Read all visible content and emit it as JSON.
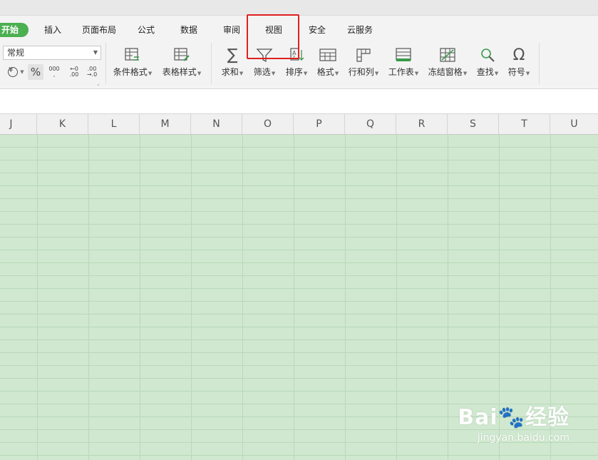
{
  "tabs": [
    {
      "label": "开始"
    },
    {
      "label": "插入"
    },
    {
      "label": "页面布局"
    },
    {
      "label": "公式"
    },
    {
      "label": "数据"
    },
    {
      "label": "审阅"
    },
    {
      "label": "视图"
    },
    {
      "label": "安全"
    },
    {
      "label": "云服务"
    }
  ],
  "number_format": {
    "value": "常规"
  },
  "format_buttons": {
    "currency": "¥",
    "percent": "%",
    "thousands": "000",
    "inc_decimal_top": "←0",
    "inc_decimal_bottom": ".00",
    "dec_decimal_top": ".00",
    "dec_decimal_bottom": "→.0"
  },
  "tools": {
    "conditional_format": "条件格式",
    "table_style": "表格样式",
    "sum": "求和",
    "filter": "筛选",
    "sort": "排序",
    "format": "格式",
    "row_col": "行和列",
    "worksheet": "工作表",
    "freeze": "冻结窗格",
    "find": "查找",
    "symbol": "符号"
  },
  "columns": [
    "J",
    "K",
    "L",
    "M",
    "N",
    "O",
    "P",
    "Q",
    "R",
    "S",
    "T",
    "U"
  ],
  "watermark": {
    "brand": "Bai",
    "brand_suffix": "经验",
    "url": "jingyan.baidu.com"
  },
  "colors": {
    "accent": "#4caf50",
    "highlight": "#e02020",
    "grid": "#cfe8cf"
  }
}
